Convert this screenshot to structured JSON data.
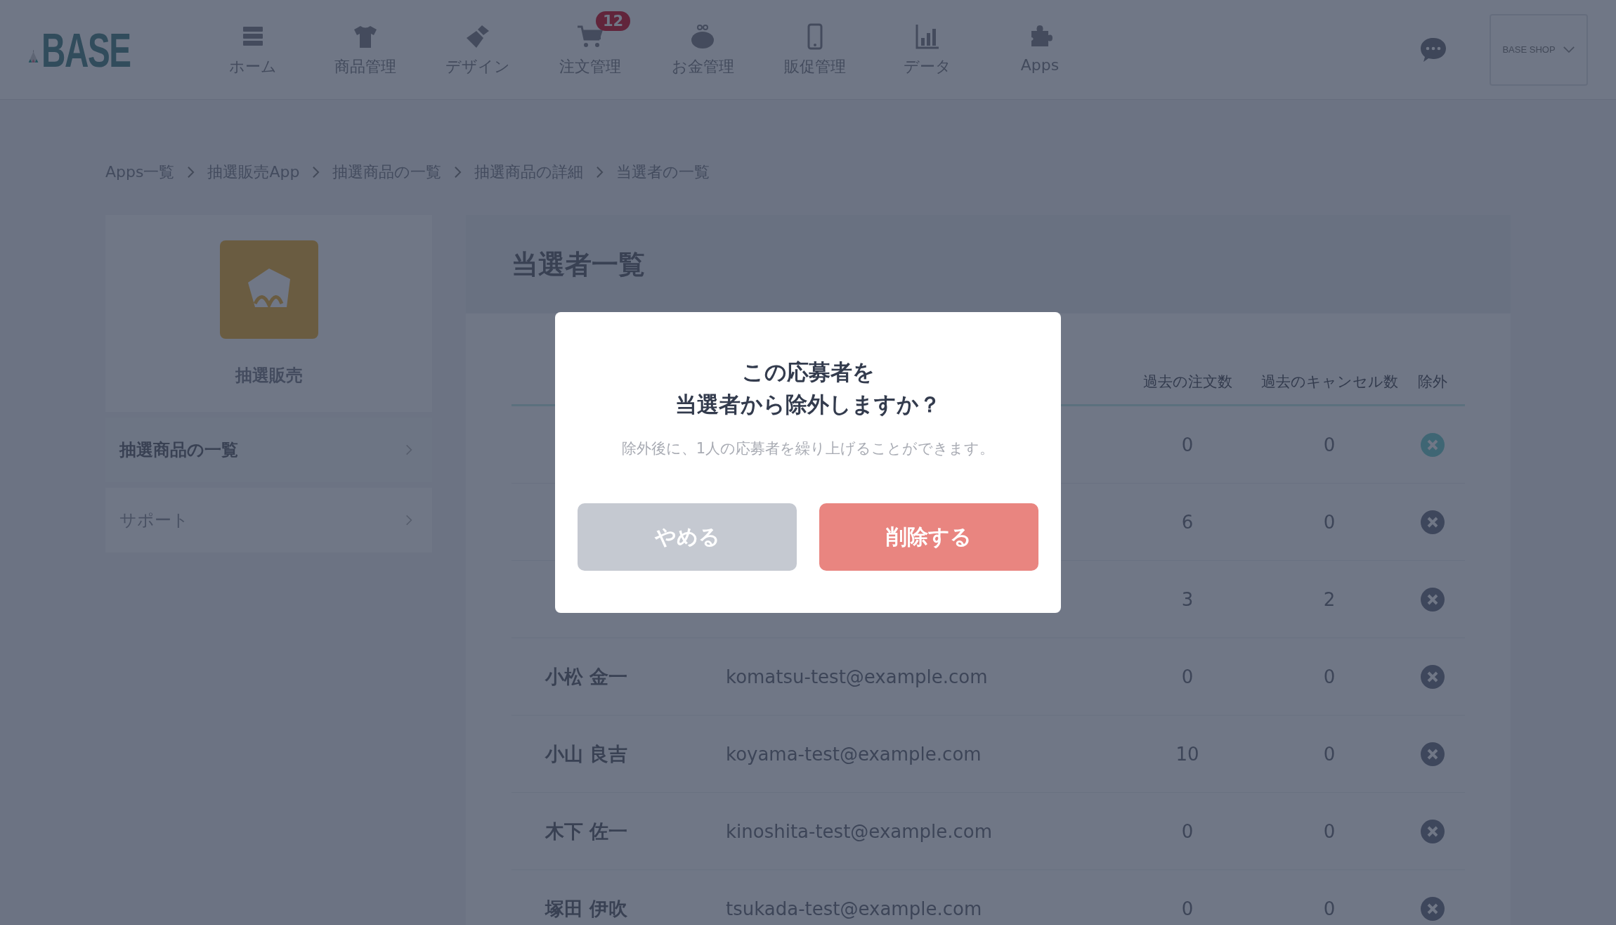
{
  "header": {
    "logo": "BASE",
    "nav": [
      {
        "label": "ホーム"
      },
      {
        "label": "商品管理"
      },
      {
        "label": "デザイン"
      },
      {
        "label": "注文管理",
        "badge": "12"
      },
      {
        "label": "お金管理"
      },
      {
        "label": "販促管理"
      },
      {
        "label": "データ"
      },
      {
        "label": "Apps"
      }
    ],
    "shop": "BASE SHOP"
  },
  "breadcrumb": [
    "Apps一覧",
    "抽選販売App",
    "抽選商品の一覧",
    "抽選商品の詳細",
    "当選者の一覧"
  ],
  "sidebar": {
    "app_name": "抽選販売",
    "items": [
      {
        "label": "抽選商品の一覧",
        "selected": true
      },
      {
        "label": "サポート",
        "selected": false
      }
    ]
  },
  "main": {
    "title": "当選者一覧",
    "table": {
      "columns": [
        "過去の注文数",
        "過去のキャンセル数",
        "除外"
      ],
      "rows": [
        {
          "orders": "0",
          "cancels": "0",
          "selected": true
        },
        {
          "orders": "6",
          "cancels": "0",
          "selected": false
        },
        {
          "orders": "3",
          "cancels": "2",
          "selected": false
        },
        {
          "name": "小松 金一",
          "email": "komatsu-test@example.com",
          "orders": "0",
          "cancels": "0",
          "selected": false
        },
        {
          "name": "小山 良吉",
          "email": "koyama-test@example.com",
          "orders": "10",
          "cancels": "0",
          "selected": false
        },
        {
          "name": "木下 佐一",
          "email": "kinoshita-test@example.com",
          "orders": "0",
          "cancels": "0",
          "selected": false
        },
        {
          "name": "塚田 伊吹",
          "email": "tsukada-test@example.com",
          "orders": "0",
          "cancels": "0",
          "selected": false
        }
      ]
    }
  },
  "dialog": {
    "title_lines": [
      "この応募者を",
      "当選者から除外しますか？"
    ],
    "message": "除外後に、1人の応募者を繰り上げることができます。",
    "buttons": [
      {
        "label": "やめる",
        "kind": "cancel"
      },
      {
        "label": "削除する",
        "kind": "danger"
      }
    ]
  }
}
